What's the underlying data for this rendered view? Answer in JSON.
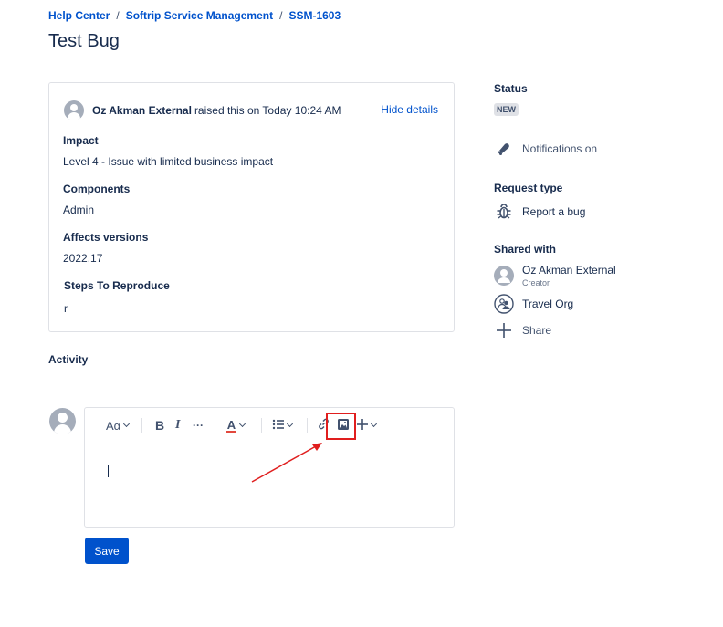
{
  "breadcrumb": {
    "items": [
      "Help Center",
      "Softrip Service Management",
      "SSM-1603"
    ],
    "separator": "/"
  },
  "page_title": "Test Bug",
  "request": {
    "raiser_name": "Oz Akman External",
    "raised_text": "raised this on Today 10:24 AM",
    "hide_details": "Hide details",
    "fields": [
      {
        "label": "Impact",
        "value": "Level 4 - Issue with limited business impact"
      },
      {
        "label": "Components",
        "value": "Admin"
      },
      {
        "label": "Affects versions",
        "value": "2022.17"
      },
      {
        "label": "Steps To Reproduce",
        "value": "r"
      }
    ]
  },
  "activity": {
    "label": "Activity",
    "toolbar": {
      "text_style": "Aα",
      "bold": "B",
      "italic": "I",
      "more_formatting": "···",
      "text_color": "A",
      "list": "list-icon",
      "link": "link-icon",
      "image": "image-icon",
      "insert": "plus-icon"
    },
    "save_label": "Save"
  },
  "sidebar": {
    "status_label": "Status",
    "status_value": "NEW",
    "notifications": "Notifications on",
    "request_type_label": "Request type",
    "request_type_value": "Report a bug",
    "shared_with_label": "Shared with",
    "shared": [
      {
        "name": "Oz Akman External",
        "role": "Creator"
      },
      {
        "name": "Travel Org"
      }
    ],
    "share": "Share"
  },
  "colors": {
    "link": "#0052cc",
    "primary_button": "#0052cc",
    "annotation": "#e01e1e",
    "text": "#172b4d"
  }
}
